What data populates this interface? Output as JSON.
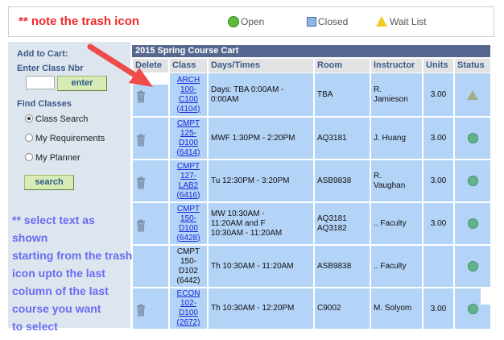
{
  "legend": {
    "note": "** note the trash icon",
    "open": "Open",
    "closed": "Closed",
    "waitlist": "Wait List"
  },
  "left_panel": {
    "add_to_cart": "Add to Cart:",
    "enter_class_nbr": "Enter Class Nbr",
    "class_nbr_value": "",
    "enter_button": "enter",
    "find_classes": "Find Classes",
    "options": [
      {
        "label": "Class Search",
        "checked": true
      },
      {
        "label": "My Requirements",
        "checked": false
      },
      {
        "label": "My Planner",
        "checked": false
      }
    ],
    "search_button": "search",
    "instructions": [
      "** select text as shown",
      "starting from the trash",
      "icon upto the last",
      "column of the last",
      "course you want",
      "to select"
    ]
  },
  "cart": {
    "title": "2015 Spring Course Cart",
    "headers": [
      "Delete",
      "Class",
      "Days/Times",
      "Room",
      "Instructor",
      "Units",
      "Status"
    ],
    "rows": [
      {
        "class_lines": [
          "ARCH",
          "100-",
          "C100",
          "(4104)"
        ],
        "linked": true,
        "trash": true,
        "times": [
          "Days: TBA 0:00AM -",
          "0:00AM"
        ],
        "room": [
          "TBA"
        ],
        "instructor": [
          "R.",
          "Jamieson"
        ],
        "units": "3.00",
        "status": "waitlist"
      },
      {
        "class_lines": [
          "CMPT",
          "125-",
          "D100",
          "(6414)"
        ],
        "linked": true,
        "trash": true,
        "times": [
          "MWF 1:30PM - 2:20PM"
        ],
        "room": [
          "AQ3181"
        ],
        "instructor": [
          "J. Huang"
        ],
        "units": "3.00",
        "status": "open"
      },
      {
        "class_lines": [
          "CMPT",
          "127-",
          "LAB2",
          "(6416)"
        ],
        "linked": true,
        "trash": true,
        "times": [
          "Tu 12:30PM - 3:20PM"
        ],
        "room": [
          "ASB9838"
        ],
        "instructor": [
          "R.",
          "Vaughan"
        ],
        "units": "3.00",
        "status": "open"
      },
      {
        "class_lines": [
          "CMPT",
          "150-",
          "D100",
          "(6428)"
        ],
        "linked": true,
        "trash": true,
        "times": [
          "MW 10:30AM -",
          "11:20AM and  F",
          "10:30AM - 11:20AM"
        ],
        "room": [
          "AQ3181",
          "AQ3182"
        ],
        "instructor": [
          ".. Faculty"
        ],
        "units": "3.00",
        "status": "open"
      },
      {
        "class_lines": [
          "CMPT",
          "150-",
          "D102",
          "(6442)"
        ],
        "linked": false,
        "trash": false,
        "times": [
          "Th 10:30AM - 11:20AM"
        ],
        "room": [
          "ASB9838"
        ],
        "instructor": [
          ".. Faculty"
        ],
        "units": "",
        "status": "open"
      },
      {
        "class_lines": [
          "ECON",
          "102-",
          "D100",
          "(2672)"
        ],
        "linked": true,
        "trash": true,
        "times": [
          "Th 10:30AM - 12:20PM"
        ],
        "room": [
          "C9002"
        ],
        "instructor": [
          "M. Solyom"
        ],
        "units": "3.00",
        "status": "open"
      }
    ]
  },
  "colors": {
    "selection": "#b3d3f7",
    "header_bar": "#56688f",
    "note_red": "#f0282a",
    "instructions_blue": "#6a6cf2"
  }
}
